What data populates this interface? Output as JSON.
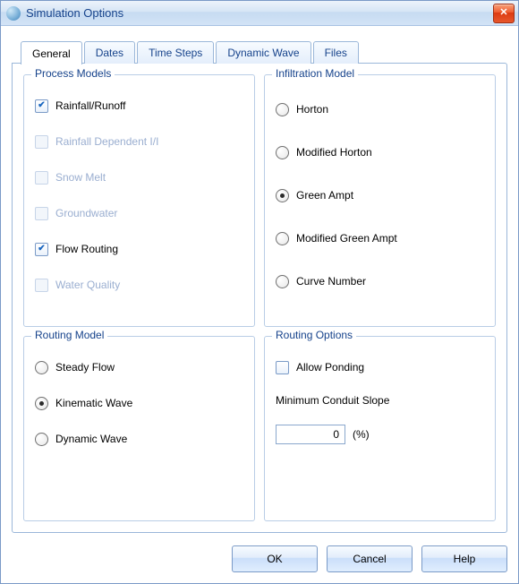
{
  "window": {
    "title": "Simulation Options"
  },
  "tabs": [
    {
      "label": "General",
      "active": true
    },
    {
      "label": "Dates"
    },
    {
      "label": "Time Steps"
    },
    {
      "label": "Dynamic Wave"
    },
    {
      "label": "Files"
    }
  ],
  "process_models": {
    "legend": "Process Models",
    "items": [
      {
        "label": "Rainfall/Runoff",
        "checked": true,
        "disabled": false
      },
      {
        "label": "Rainfall Dependent I/I",
        "checked": false,
        "disabled": true
      },
      {
        "label": "Snow Melt",
        "checked": false,
        "disabled": true
      },
      {
        "label": "Groundwater",
        "checked": false,
        "disabled": true
      },
      {
        "label": "Flow Routing",
        "checked": true,
        "disabled": false
      },
      {
        "label": "Water Quality",
        "checked": false,
        "disabled": true
      }
    ]
  },
  "infiltration_model": {
    "legend": "Infiltration Model",
    "selected": "Green Ampt",
    "options": [
      {
        "label": "Horton"
      },
      {
        "label": "Modified Horton"
      },
      {
        "label": "Green Ampt"
      },
      {
        "label": "Modified Green Ampt"
      },
      {
        "label": "Curve Number"
      }
    ]
  },
  "routing_model": {
    "legend": "Routing Model",
    "selected": "Kinematic Wave",
    "options": [
      {
        "label": "Steady Flow"
      },
      {
        "label": "Kinematic Wave"
      },
      {
        "label": "Dynamic Wave"
      }
    ]
  },
  "routing_options": {
    "legend": "Routing Options",
    "allow_ponding": {
      "label": "Allow Ponding",
      "checked": false
    },
    "min_slope_label": "Minimum Conduit Slope",
    "min_slope_value": "0",
    "min_slope_unit": "(%)"
  },
  "buttons": {
    "ok": "OK",
    "cancel": "Cancel",
    "help": "Help"
  }
}
